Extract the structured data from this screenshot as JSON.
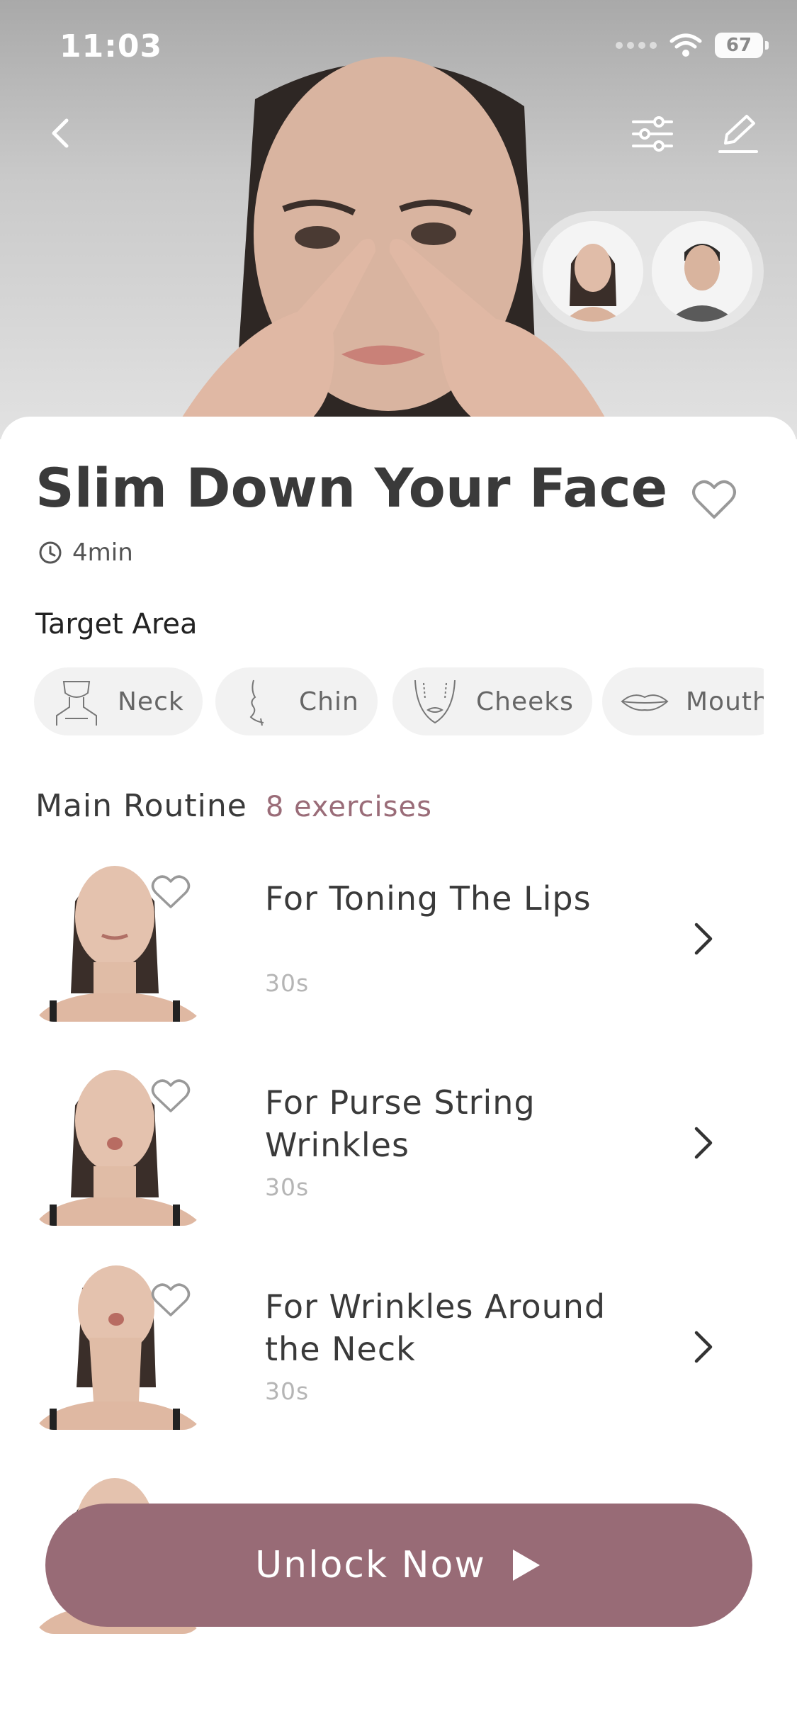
{
  "status_bar": {
    "time": "11:03",
    "battery": "67"
  },
  "title": "Slim Down Your Face",
  "duration": "4min",
  "target_area": {
    "label": "Target Area",
    "chips": [
      {
        "label": "Neck",
        "icon": "neck-icon"
      },
      {
        "label": "Chin",
        "icon": "chin-icon"
      },
      {
        "label": "Cheeks",
        "icon": "cheeks-icon"
      },
      {
        "label": "Mouth",
        "icon": "mouth-icon"
      }
    ]
  },
  "routine": {
    "title": "Main Routine",
    "count": "8 exercises",
    "exercises": [
      {
        "title": "For Toning The Lips",
        "duration": "30s"
      },
      {
        "title": "For Purse String Wrinkles",
        "duration": "30s"
      },
      {
        "title": "For Wrinkles Around the Neck",
        "duration": "30s"
      }
    ]
  },
  "cta": {
    "label": "Unlock Now"
  },
  "colors": {
    "accent": "#986b76",
    "count_text": "#9a6c78",
    "chip_bg": "#f2f2f2"
  }
}
